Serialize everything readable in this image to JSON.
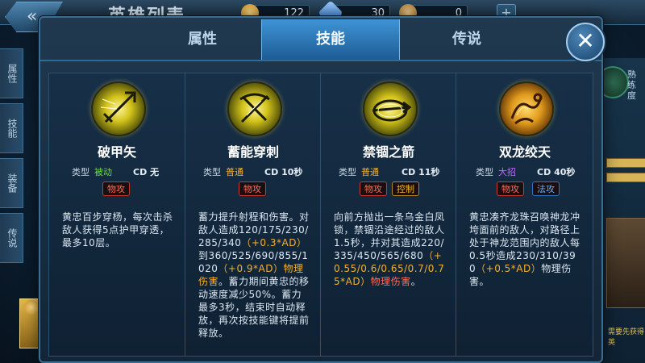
{
  "background": {
    "title": "英雄列表",
    "resources": {
      "gold": "122",
      "gems": "30",
      "tickets": "0"
    },
    "plus": "+",
    "left_tabs": [
      "属性",
      "技能",
      "装备",
      "传说"
    ],
    "right_label": "熟练度",
    "right_note": "需要先获得英"
  },
  "tabs": [
    "属性",
    "技能",
    "传说"
  ],
  "active_tab": "技能",
  "close_icon": "close-icon",
  "labels": {
    "type": "类型",
    "cd": "CD"
  },
  "skills": [
    {
      "name": "破甲矢",
      "icon": "piercing-arrow-icon",
      "type": "被动",
      "type_color": "#6dde3c",
      "cd": "无",
      "badges": [
        {
          "text": "物攻",
          "kind": "phys"
        }
      ],
      "desc": [
        {
          "t": "黄忠百步穿杨，每次击杀敌人获得5点护甲穿透，最多10层。",
          "c": ""
        }
      ]
    },
    {
      "name": "蓄能穿刺",
      "icon": "charged-bow-icon",
      "type": "普通",
      "type_color": "#f0b43a",
      "cd": "10秒",
      "badges": [
        {
          "text": "物攻",
          "kind": "phys"
        }
      ],
      "desc": [
        {
          "t": "蓄力提升射程和伤害。对敌人造成120/175/230/285/340",
          "c": ""
        },
        {
          "t": "（+0.3*AD）",
          "c": "orange"
        },
        {
          "t": "到360/525/690/855/1020",
          "c": ""
        },
        {
          "t": "（+0.9*AD）物理伤害",
          "c": "orange"
        },
        {
          "t": "。蓄力期间黄忠的移动速度减少50%。蓄力最多3秒，结束时自动释放，再次按技能键将提前释放。",
          "c": ""
        }
      ]
    },
    {
      "name": "禁锢之箭",
      "icon": "binding-arrow-icon",
      "type": "普通",
      "type_color": "#f0b43a",
      "cd": "11秒",
      "badges": [
        {
          "text": "物攻",
          "kind": "phys"
        },
        {
          "text": "控制",
          "kind": "ctrl"
        }
      ],
      "desc": [
        {
          "t": "向前方抛出一条乌金白凤锁，禁锢沿途经过的敌人1.5秒，并对其造成220/335/450/565/680",
          "c": ""
        },
        {
          "t": "（+0.55/0.6/0.65/0.7/0.75*AD）",
          "c": "orange"
        },
        {
          "t": "物理伤害",
          "c": "red"
        },
        {
          "t": "。",
          "c": ""
        }
      ]
    },
    {
      "name": "双龙绞天",
      "icon": "twin-dragon-icon",
      "type": "大招",
      "type_color": "#c06bff",
      "cd": "40秒",
      "badges": [
        {
          "text": "物攻",
          "kind": "phys"
        },
        {
          "text": "法攻",
          "kind": "mag"
        }
      ],
      "desc": [
        {
          "t": "黄忠凑齐龙珠召唤神龙冲垮面前的敌人，对路径上处于神龙范围内的敌人每0.5秒造成230/310/390",
          "c": ""
        },
        {
          "t": "（+0.5*AD）",
          "c": "orange"
        },
        {
          "t": "物理伤害。",
          "c": ""
        }
      ]
    }
  ]
}
